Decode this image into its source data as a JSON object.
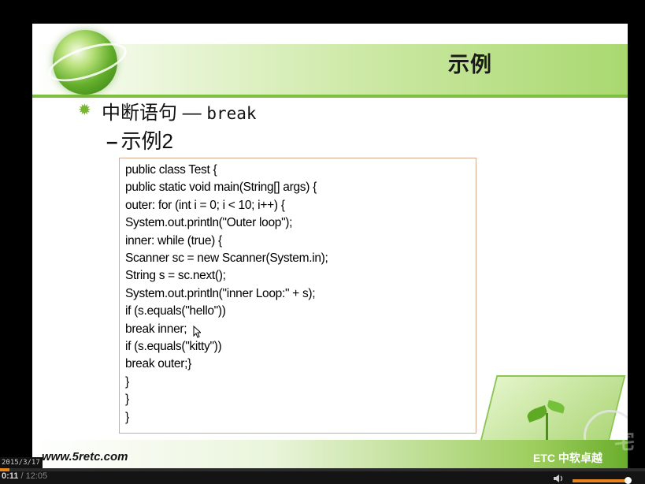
{
  "slide": {
    "title": "示例",
    "bullet": {
      "text": "中断语句 —",
      "keyword": "break"
    },
    "subheading": {
      "dash": "–",
      "text": "示例2"
    },
    "code_lines": [
      "public class Test {",
      "public static void main(String[] args) {",
      "outer: for (int i = 0; i < 10; i++) {",
      "System.out.println(\"Outer loop\");",
      "inner: while (true) {",
      "Scanner sc = new Scanner(System.in);",
      "String s = sc.next();",
      "System.out.println(\"inner Loop:\" + s);",
      "if (s.equals(\"hello\"))",
      "break inner;",
      "if (s.equals(\"kitty\"))",
      "break outer;}",
      "}",
      "}",
      "}"
    ],
    "footer": {
      "url": "www.5retc.com",
      "brand": "ETC 中软卓越"
    }
  },
  "player": {
    "date_stamp": "2015/3/17",
    "time_current": "0:11",
    "time_separator": " / ",
    "time_total": "12:05",
    "progress_fraction": 0.015,
    "volume_fraction": 0.95,
    "watermark": "宅"
  },
  "colors": {
    "accent_green": "#7fbf3f",
    "progress": "#e8841b",
    "code_border": "#d9a98f"
  }
}
